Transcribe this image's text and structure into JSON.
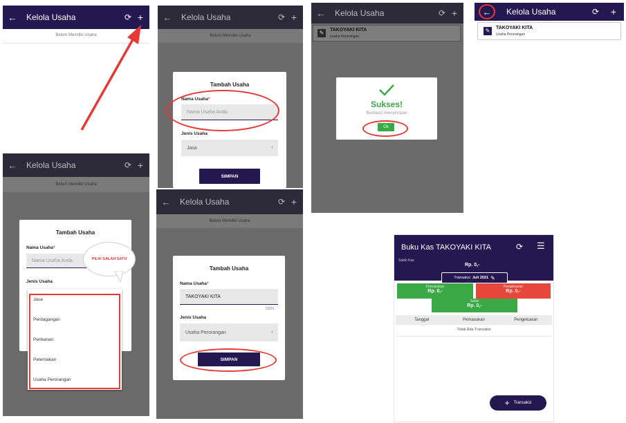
{
  "screen1": {
    "title": "Kelola Usaha",
    "empty_text": "Belum Memiliki Usaha"
  },
  "screen2": {
    "title": "Kelola Usaha",
    "empty_text": "Belum Memiliki Usaha",
    "dialog_title": "Tambah Usaha",
    "name_label": "Nama Usaha",
    "name_required": "*",
    "name_placeholder": "Nama Usaha Anda",
    "type_label": "Jenis Usaha",
    "type_value": "Jasa",
    "save_label": "SIMPAN"
  },
  "screen3": {
    "title": "Kelola Usaha",
    "business_name": "TAKOYAKI KITA",
    "business_type": "Usaha Perorangan",
    "success_title": "Sukses!",
    "success_message": "Berhasil menyimpan",
    "ok_label": "Ok"
  },
  "screen4": {
    "title": "Kelola Usaha",
    "business_name": "TAKOYAKI KITA",
    "business_type": "Usaha Perorangan"
  },
  "screen5": {
    "title": "Kelola Usaha",
    "empty_text": "Belum Memiliki Usaha",
    "dialog_title": "Tambah Usaha",
    "name_label": "Nama Usaha",
    "name_required": "*",
    "name_placeholder": "Nama Usaha Anda",
    "callout": "PILIH SALAH SATU",
    "type_label": "Jenis Usaha",
    "options": [
      "Jasa",
      "Perdagangan",
      "Perikanan",
      "Peternakan",
      "Usaha Perorangan"
    ]
  },
  "screen6": {
    "title": "Kelola Usaha",
    "empty_text": "Belum Memiliki Usaha",
    "dialog_title": "Tambah Usaha",
    "name_label": "Nama Usaha",
    "name_required": "*",
    "name_value": "TAKOYAKI KITA",
    "counter": "13/20",
    "type_label": "Jenis Usaha",
    "type_value": "Usaha Perorangan",
    "save_label": "SIMPAN"
  },
  "screen7": {
    "title": "Buku Kas TAKOYAKI KITA",
    "saldo_kas_label": "Saldo Kas",
    "saldo_kas_value": "Rp. 0,-",
    "transaksi_label": "Transaksi",
    "transaksi_period": "Juli 2021",
    "pemasukan_label": "Pemasukan",
    "pemasukan_value": "Rp. 0,-",
    "pengeluaran_label": "Pengeluaran",
    "pengeluaran_value": "Rp. 0,-",
    "saldo_label": "Saldo",
    "saldo_value": "Rp. 0,-",
    "columns": [
      "Tanggal",
      "Pemasukan",
      "Pengeluaran"
    ],
    "empty_text": "Tidak Ada Transaksi",
    "fab_label": "Transaksi"
  },
  "icons": [
    "back-arrow-icon",
    "sync-icon",
    "add-icon",
    "edit-icon",
    "checkmark-icon",
    "menu-icon",
    "dropdown-caret-icon"
  ],
  "colors": {
    "appbar": "#23184f",
    "accent_red": "#e53935",
    "success_green": "#3aa845",
    "pengeluaran_red": "#e5483a"
  }
}
